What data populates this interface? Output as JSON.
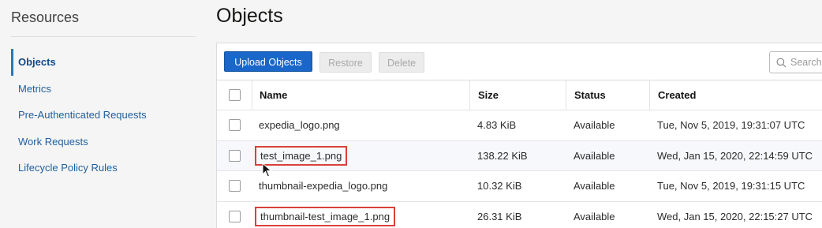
{
  "sidebar": {
    "title": "Resources",
    "items": [
      {
        "label": "Objects",
        "active": true
      },
      {
        "label": "Metrics"
      },
      {
        "label": "Pre-Authenticated Requests"
      },
      {
        "label": "Work Requests"
      },
      {
        "label": "Lifecycle Policy Rules"
      }
    ]
  },
  "main": {
    "title": "Objects",
    "toolbar": {
      "upload_label": "Upload Objects",
      "restore_label": "Restore",
      "delete_label": "Delete",
      "search_placeholder": "Search"
    },
    "table": {
      "headers": {
        "name": "Name",
        "size": "Size",
        "status": "Status",
        "created": "Created"
      },
      "rows": [
        {
          "name": "expedia_logo.png",
          "size": "4.83 KiB",
          "status": "Available",
          "created": "Tue, Nov 5, 2019, 19:31:07 UTC"
        },
        {
          "name": "test_image_1.png",
          "size": "138.22 KiB",
          "status": "Available",
          "created": "Wed, Jan 15, 2020, 22:14:59 UTC",
          "highlighted": true
        },
        {
          "name": "thumbnail-expedia_logo.png",
          "size": "10.32 KiB",
          "status": "Available",
          "created": "Tue, Nov 5, 2019, 19:31:15 UTC"
        },
        {
          "name": "thumbnail-test_image_1.png",
          "size": "26.31 KiB",
          "status": "Available",
          "created": "Wed, Jan 15, 2020, 22:15:27 UTC",
          "highlighted": true
        }
      ]
    }
  },
  "colors": {
    "accent": "#1b66c9",
    "link": "#1f5e9e",
    "highlight_box": "#d9413b"
  }
}
